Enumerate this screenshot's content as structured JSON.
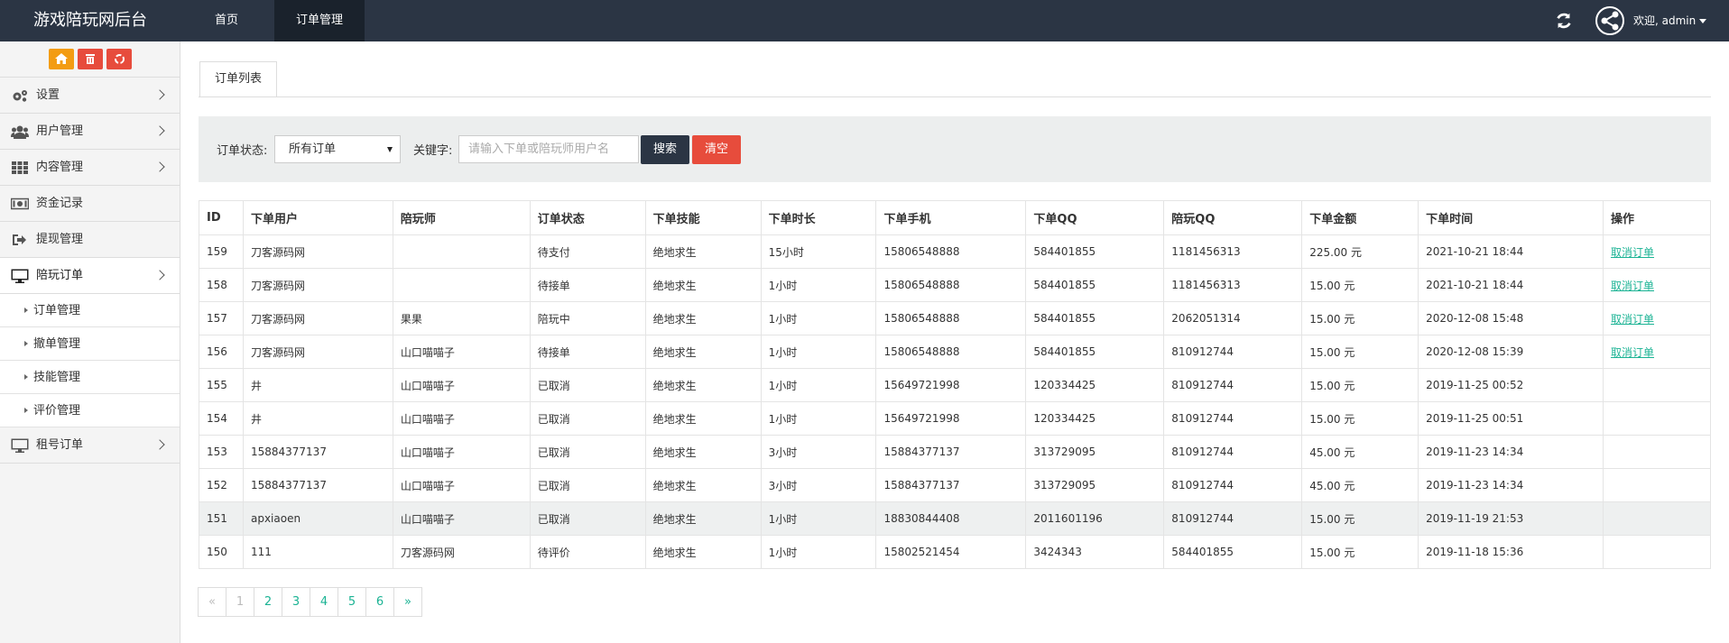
{
  "header": {
    "brand": "游戏陪玩网后台",
    "nav": [
      "首页",
      "订单管理"
    ],
    "welcome": "欢迎, admin"
  },
  "sidebar": {
    "items": [
      {
        "label": "设置",
        "icon": "gears-icon"
      },
      {
        "label": "用户管理",
        "icon": "users-icon"
      },
      {
        "label": "内容管理",
        "icon": "grid-icon"
      },
      {
        "label": "资金记录",
        "icon": "money-icon"
      },
      {
        "label": "提现管理",
        "icon": "sign-out-icon"
      },
      {
        "label": "陪玩订单",
        "icon": "desktop-icon"
      },
      {
        "label": "租号订单",
        "icon": "desktop-icon"
      }
    ],
    "sub_items": [
      "订单管理",
      "撤单管理",
      "技能管理",
      "评价管理"
    ]
  },
  "tab": {
    "label": "订单列表"
  },
  "filter": {
    "status_label": "订单状态:",
    "status_value": "所有订单",
    "keyword_label": "关键字:",
    "keyword_placeholder": "请输入下单或陪玩师用户名",
    "search_label": "搜索",
    "clear_label": "清空"
  },
  "table": {
    "headers": [
      "ID",
      "下单用户",
      "陪玩师",
      "订单状态",
      "下单技能",
      "下单时长",
      "下单手机",
      "下单QQ",
      "陪玩QQ",
      "下单金额",
      "下单时间",
      "操作"
    ],
    "rows": [
      [
        "159",
        "刀客源码网",
        "",
        "待支付",
        "绝地求生",
        "15小时",
        "15806548888",
        "584401855",
        "1181456313",
        "225.00 元",
        "2021-10-21 18:44",
        "取消订单"
      ],
      [
        "158",
        "刀客源码网",
        "",
        "待接单",
        "绝地求生",
        "1小时",
        "15806548888",
        "584401855",
        "1181456313",
        "15.00 元",
        "2021-10-21 18:44",
        "取消订单"
      ],
      [
        "157",
        "刀客源码网",
        "果果",
        "陪玩中",
        "绝地求生",
        "1小时",
        "15806548888",
        "584401855",
        "2062051314",
        "15.00 元",
        "2020-12-08 15:48",
        "取消订单"
      ],
      [
        "156",
        "刀客源码网",
        "山口喵喵子",
        "待接单",
        "绝地求生",
        "1小时",
        "15806548888",
        "584401855",
        "810912744",
        "15.00 元",
        "2020-12-08 15:39",
        "取消订单"
      ],
      [
        "155",
        "井",
        "山口喵喵子",
        "已取消",
        "绝地求生",
        "1小时",
        "15649721998",
        "120334425",
        "810912744",
        "15.00 元",
        "2019-11-25 00:52",
        ""
      ],
      [
        "154",
        "井",
        "山口喵喵子",
        "已取消",
        "绝地求生",
        "1小时",
        "15649721998",
        "120334425",
        "810912744",
        "15.00 元",
        "2019-11-25 00:51",
        ""
      ],
      [
        "153",
        "15884377137",
        "山口喵喵子",
        "已取消",
        "绝地求生",
        "3小时",
        "15884377137",
        "313729095",
        "810912744",
        "45.00 元",
        "2019-11-23 14:34",
        ""
      ],
      [
        "152",
        "15884377137",
        "山口喵喵子",
        "已取消",
        "绝地求生",
        "3小时",
        "15884377137",
        "313729095",
        "810912744",
        "45.00 元",
        "2019-11-23 14:34",
        ""
      ],
      [
        "151",
        "apxiaoen",
        "山口喵喵子",
        "已取消",
        "绝地求生",
        "1小时",
        "18830844408",
        "2011601196",
        "810912744",
        "15.00 元",
        "2019-11-19 21:53",
        ""
      ],
      [
        "150",
        "111",
        "刀客源码网",
        "待评价",
        "绝地求生",
        "1小时",
        "15802521454",
        "3424343",
        "584401855",
        "15.00 元",
        "2019-11-18 15:36",
        ""
      ]
    ],
    "highlighted_row": 8
  },
  "pagination": [
    "«",
    "1",
    "2",
    "3",
    "4",
    "5",
    "6",
    "»"
  ],
  "colors": {
    "topbar": "#2b3544",
    "accent_link": "#1bb394",
    "danger": "#e74c3c",
    "warning": "#f39c12"
  }
}
